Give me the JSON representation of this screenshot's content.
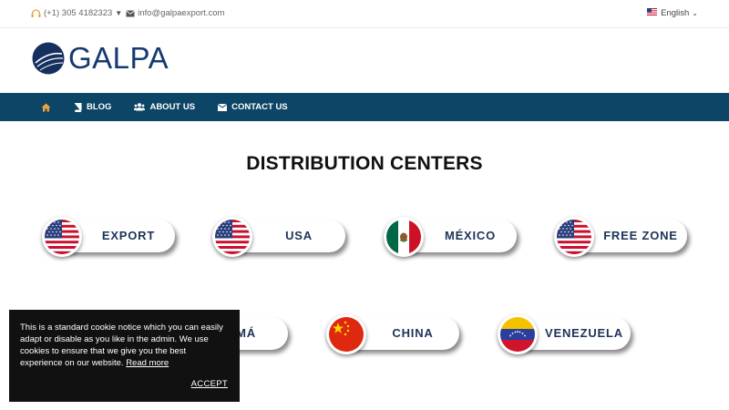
{
  "topbar": {
    "phone": "(+1) 305 4182323",
    "email": "info@galpaexport.com",
    "language": "English",
    "accent_color": "#e8a33c"
  },
  "logo": {
    "text": "GALPA"
  },
  "nav": {
    "items": [
      {
        "label": "BLOG",
        "icon": "book-icon"
      },
      {
        "label": "ABOUT US",
        "icon": "users-icon"
      },
      {
        "label": "CONTACT US",
        "icon": "envelope-icon"
      }
    ],
    "background": "#0d4566"
  },
  "main": {
    "title": "DISTRIBUTION CENTERS",
    "centers": [
      {
        "label": "EXPORT",
        "flag": "us-flag-icon"
      },
      {
        "label": "USA",
        "flag": "us-flag-icon"
      },
      {
        "label": "MÉXICO",
        "flag": "mexico-flag-icon"
      },
      {
        "label": "FREE ZONE",
        "flag": "us-flag-icon"
      },
      {
        "label": "AMÁ",
        "flag": "panama-flag-icon"
      },
      {
        "label": "CHINA",
        "flag": "china-flag-icon"
      },
      {
        "label": "VENEZUELA",
        "flag": "venezuela-flag-icon"
      }
    ]
  },
  "cookie": {
    "text": "This is a standard cookie notice which you can easily adapt or disable as you like in the admin. We use cookies to ensure that we give you the best experience on our website.",
    "link": "Read more",
    "accept": "ACCEPT"
  }
}
